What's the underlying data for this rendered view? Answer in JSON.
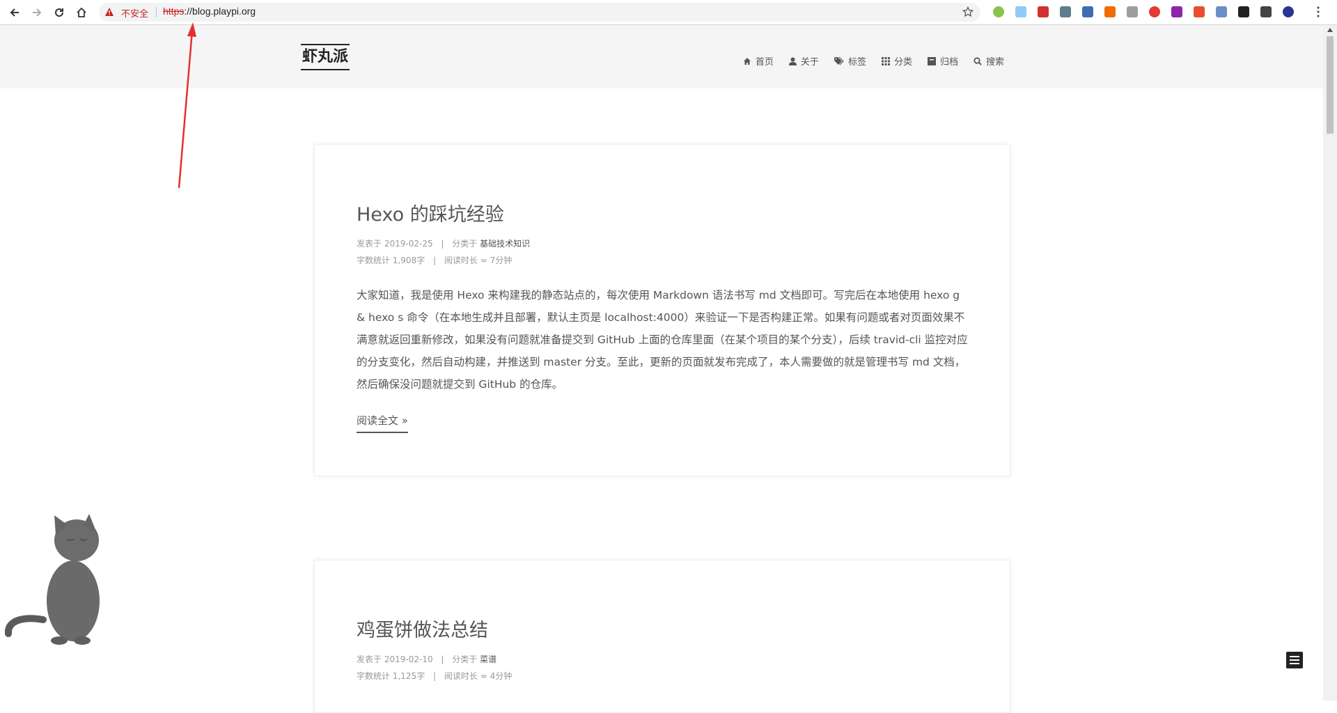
{
  "browser": {
    "security_label": "不安全",
    "url_scheme": "https",
    "url_rest": "://blog.playpi.org",
    "extensions": [
      {
        "name": "ext-green-circle",
        "color": "#8bc34a"
      },
      {
        "name": "ext-cloud",
        "color": "#90caf9"
      },
      {
        "name": "ext-abp",
        "color": "#d32f2f"
      },
      {
        "name": "ext-ip",
        "color": "#607d8b"
      },
      {
        "name": "ext-star-box",
        "color": "#3f6db3"
      },
      {
        "name": "ext-fox",
        "color": "#ef6c00"
      },
      {
        "name": "ext-umbrella",
        "color": "#9e9e9e"
      },
      {
        "name": "ext-red-circle",
        "color": "#e53935"
      },
      {
        "name": "ext-purple",
        "color": "#8e24aa"
      },
      {
        "name": "ext-weibo",
        "color": "#e6502d"
      },
      {
        "name": "ext-blue-round",
        "color": "#6a8fc7"
      },
      {
        "name": "ext-black-x",
        "color": "#222222"
      },
      {
        "name": "ext-aperture",
        "color": "#444444"
      },
      {
        "name": "ext-navy-circle",
        "color": "#283593"
      }
    ]
  },
  "site": {
    "brand": "虾丸派",
    "menu": [
      {
        "label": "首页",
        "icon": "home-icon"
      },
      {
        "label": "关于",
        "icon": "user-icon"
      },
      {
        "label": "标签",
        "icon": "tags-icon"
      },
      {
        "label": "分类",
        "icon": "grid-icon"
      },
      {
        "label": "归档",
        "icon": "archive-icon"
      },
      {
        "label": "搜索",
        "icon": "search-icon"
      }
    ]
  },
  "posts": [
    {
      "title": "Hexo 的踩坑经验",
      "posted_label": "发表于",
      "date": "2019-02-25",
      "category_label": "分类于",
      "category": "基础技术知识",
      "wordcount_label": "字数统计",
      "wordcount": "1,908字",
      "readtime_label": "阅读时长 ≈",
      "readtime": "7分钟",
      "excerpt": "大家知道，我是使用 Hexo 来构建我的静态站点的，每次使用 Markdown 语法书写 md 文档即可。写完后在本地使用 hexo g & hexo s 命令（在本地生成并且部署，默认主页是 localhost:4000）来验证一下是否构建正常。如果有问题或者对页面效果不满意就返回重新修改，如果没有问题就准备提交到 GitHub 上面的仓库里面（在某个项目的某个分支），后续 travid-cli 监控对应的分支变化，然后自动构建，并推送到 master 分支。至此，更新的页面就发布完成了，本人需要做的就是管理书写 md 文档，然后确保没问题就提交到 GitHub 的仓库。",
      "read_more": "阅读全文 »"
    },
    {
      "title": "鸡蛋饼做法总结",
      "posted_label": "发表于",
      "date": "2019-02-10",
      "category_label": "分类于",
      "category": "菜谱",
      "wordcount_label": "字数统计",
      "wordcount": "1,125字",
      "readtime_label": "阅读时长 ≈",
      "readtime": "4分钟"
    }
  ]
}
